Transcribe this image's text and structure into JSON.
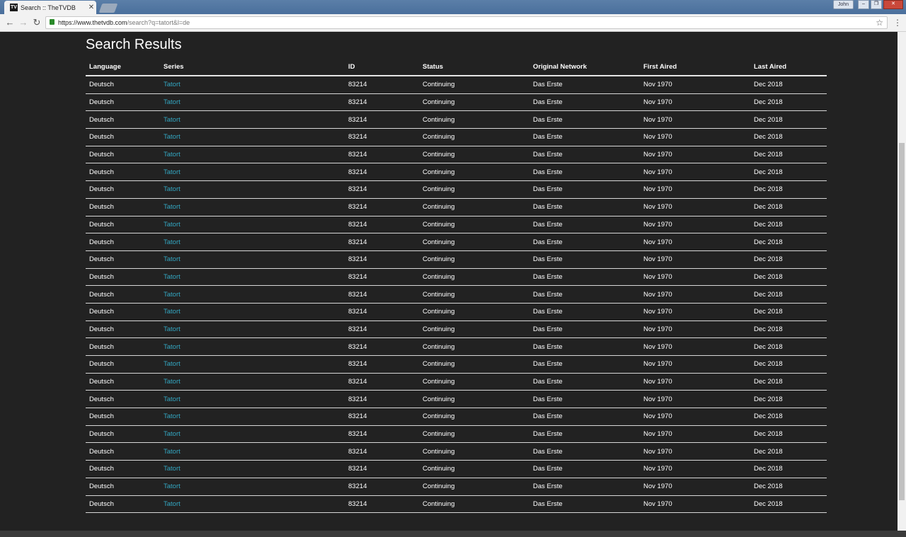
{
  "browser": {
    "tab_title": "Search :: TheTVDB",
    "tab_favicon": "TV",
    "user_name": "John",
    "url_host": "https://www.thetvdb.com",
    "url_path": "/search?q=tatort&l=de"
  },
  "page": {
    "title": "Search Results",
    "columns": [
      "Language",
      "Series",
      "ID",
      "Status",
      "Original Network",
      "First Aired",
      "Last Aired"
    ],
    "rows": [
      {
        "language": "Deutsch",
        "series": "Tatort",
        "id": "83214",
        "status": "Continuing",
        "network": "Das Erste",
        "first": "Nov 1970",
        "last": "Dec 2018"
      },
      {
        "language": "Deutsch",
        "series": "Tatort",
        "id": "83214",
        "status": "Continuing",
        "network": "Das Erste",
        "first": "Nov 1970",
        "last": "Dec 2018"
      },
      {
        "language": "Deutsch",
        "series": "Tatort",
        "id": "83214",
        "status": "Continuing",
        "network": "Das Erste",
        "first": "Nov 1970",
        "last": "Dec 2018"
      },
      {
        "language": "Deutsch",
        "series": "Tatort",
        "id": "83214",
        "status": "Continuing",
        "network": "Das Erste",
        "first": "Nov 1970",
        "last": "Dec 2018"
      },
      {
        "language": "Deutsch",
        "series": "Tatort",
        "id": "83214",
        "status": "Continuing",
        "network": "Das Erste",
        "first": "Nov 1970",
        "last": "Dec 2018"
      },
      {
        "language": "Deutsch",
        "series": "Tatort",
        "id": "83214",
        "status": "Continuing",
        "network": "Das Erste",
        "first": "Nov 1970",
        "last": "Dec 2018"
      },
      {
        "language": "Deutsch",
        "series": "Tatort",
        "id": "83214",
        "status": "Continuing",
        "network": "Das Erste",
        "first": "Nov 1970",
        "last": "Dec 2018"
      },
      {
        "language": "Deutsch",
        "series": "Tatort",
        "id": "83214",
        "status": "Continuing",
        "network": "Das Erste",
        "first": "Nov 1970",
        "last": "Dec 2018"
      },
      {
        "language": "Deutsch",
        "series": "Tatort",
        "id": "83214",
        "status": "Continuing",
        "network": "Das Erste",
        "first": "Nov 1970",
        "last": "Dec 2018"
      },
      {
        "language": "Deutsch",
        "series": "Tatort",
        "id": "83214",
        "status": "Continuing",
        "network": "Das Erste",
        "first": "Nov 1970",
        "last": "Dec 2018"
      },
      {
        "language": "Deutsch",
        "series": "Tatort",
        "id": "83214",
        "status": "Continuing",
        "network": "Das Erste",
        "first": "Nov 1970",
        "last": "Dec 2018"
      },
      {
        "language": "Deutsch",
        "series": "Tatort",
        "id": "83214",
        "status": "Continuing",
        "network": "Das Erste",
        "first": "Nov 1970",
        "last": "Dec 2018"
      },
      {
        "language": "Deutsch",
        "series": "Tatort",
        "id": "83214",
        "status": "Continuing",
        "network": "Das Erste",
        "first": "Nov 1970",
        "last": "Dec 2018"
      },
      {
        "language": "Deutsch",
        "series": "Tatort",
        "id": "83214",
        "status": "Continuing",
        "network": "Das Erste",
        "first": "Nov 1970",
        "last": "Dec 2018"
      },
      {
        "language": "Deutsch",
        "series": "Tatort",
        "id": "83214",
        "status": "Continuing",
        "network": "Das Erste",
        "first": "Nov 1970",
        "last": "Dec 2018"
      },
      {
        "language": "Deutsch",
        "series": "Tatort",
        "id": "83214",
        "status": "Continuing",
        "network": "Das Erste",
        "first": "Nov 1970",
        "last": "Dec 2018"
      },
      {
        "language": "Deutsch",
        "series": "Tatort",
        "id": "83214",
        "status": "Continuing",
        "network": "Das Erste",
        "first": "Nov 1970",
        "last": "Dec 2018"
      },
      {
        "language": "Deutsch",
        "series": "Tatort",
        "id": "83214",
        "status": "Continuing",
        "network": "Das Erste",
        "first": "Nov 1970",
        "last": "Dec 2018"
      },
      {
        "language": "Deutsch",
        "series": "Tatort",
        "id": "83214",
        "status": "Continuing",
        "network": "Das Erste",
        "first": "Nov 1970",
        "last": "Dec 2018"
      },
      {
        "language": "Deutsch",
        "series": "Tatort",
        "id": "83214",
        "status": "Continuing",
        "network": "Das Erste",
        "first": "Nov 1970",
        "last": "Dec 2018"
      },
      {
        "language": "Deutsch",
        "series": "Tatort",
        "id": "83214",
        "status": "Continuing",
        "network": "Das Erste",
        "first": "Nov 1970",
        "last": "Dec 2018"
      },
      {
        "language": "Deutsch",
        "series": "Tatort",
        "id": "83214",
        "status": "Continuing",
        "network": "Das Erste",
        "first": "Nov 1970",
        "last": "Dec 2018"
      },
      {
        "language": "Deutsch",
        "series": "Tatort",
        "id": "83214",
        "status": "Continuing",
        "network": "Das Erste",
        "first": "Nov 1970",
        "last": "Dec 2018"
      },
      {
        "language": "Deutsch",
        "series": "Tatort",
        "id": "83214",
        "status": "Continuing",
        "network": "Das Erste",
        "first": "Nov 1970",
        "last": "Dec 2018"
      },
      {
        "language": "Deutsch",
        "series": "Tatort",
        "id": "83214",
        "status": "Continuing",
        "network": "Das Erste",
        "first": "Nov 1970",
        "last": "Dec 2018"
      }
    ]
  },
  "colors": {
    "background": "#222222",
    "text": "#ffffff",
    "link": "#33a7c2"
  },
  "icons": {
    "back": "arrow-left-icon",
    "forward": "arrow-right-icon",
    "reload": "reload-icon",
    "lock": "lock-icon",
    "bookmark": "star-icon",
    "menu": "kebab-menu-icon"
  }
}
